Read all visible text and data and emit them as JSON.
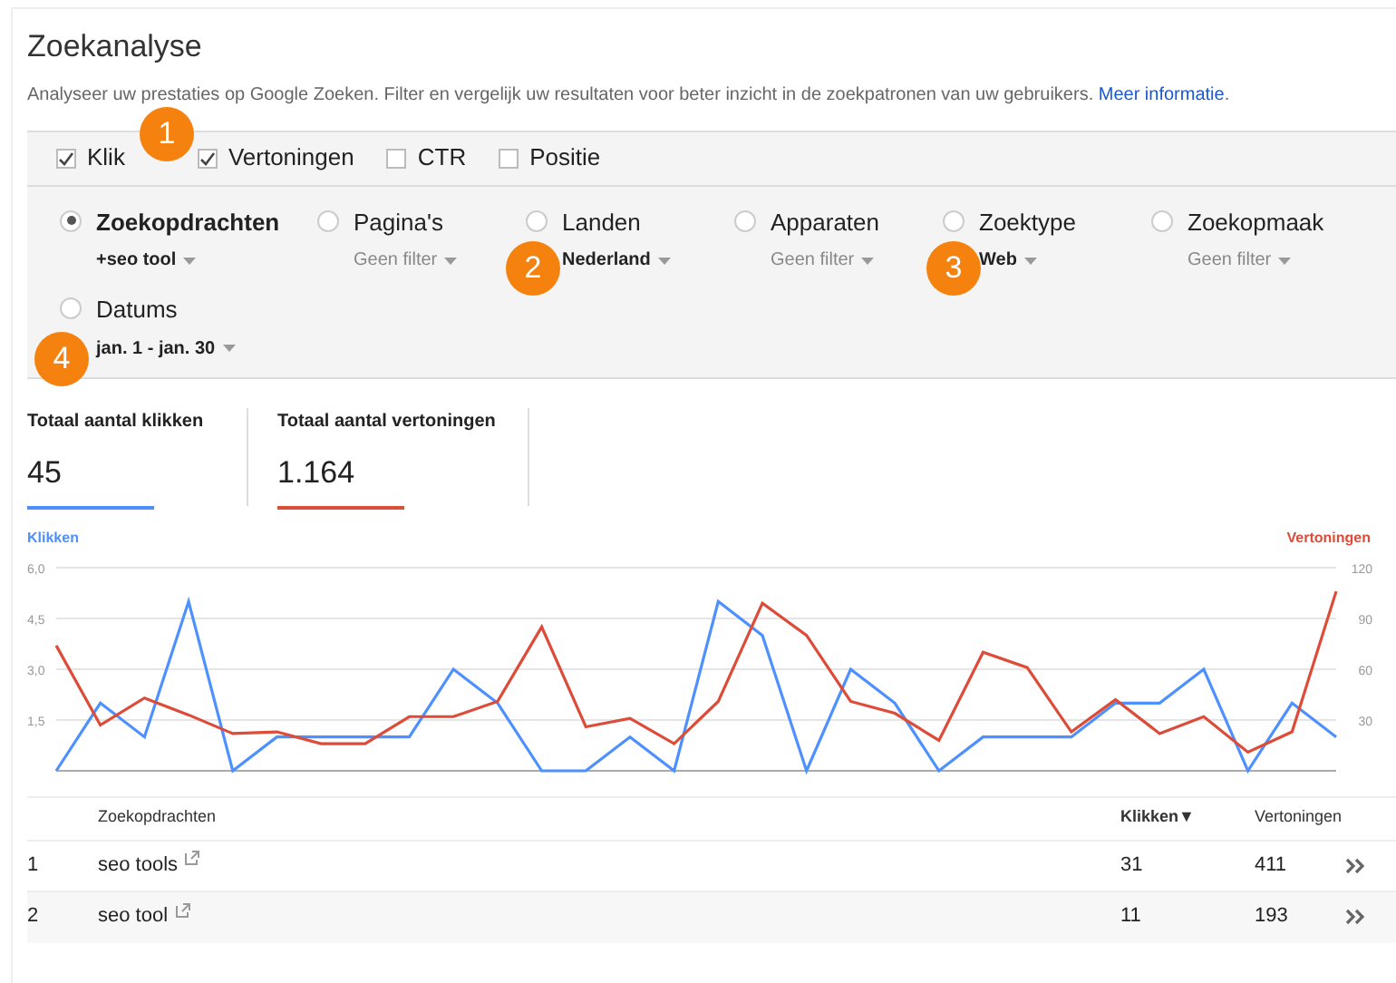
{
  "page": {
    "title": "Zoekanalyse",
    "description": "Analyseer uw prestaties op Google Zoeken. Filter en vergelijk uw resultaten voor beter inzicht in de zoekpatronen van uw gebruikers.",
    "link": "Meer informatie",
    "link_end": "."
  },
  "metrics": [
    {
      "label": "Klik",
      "checked": true
    },
    {
      "label": "Vertoningen",
      "checked": true
    },
    {
      "label": "CTR",
      "checked": false
    },
    {
      "label": "Positie",
      "checked": false
    }
  ],
  "filters": [
    {
      "label": "Zoekopdrachten",
      "selected": true,
      "value": "+seo tool",
      "filtered": true
    },
    {
      "label": "Pagina's",
      "selected": false,
      "value": "Geen filter",
      "filtered": false
    },
    {
      "label": "Landen",
      "selected": false,
      "value": "Nederland",
      "filtered": true
    },
    {
      "label": "Apparaten",
      "selected": false,
      "value": "Geen filter",
      "filtered": false
    },
    {
      "label": "Zoektype",
      "selected": false,
      "value": "Web",
      "filtered": true
    },
    {
      "label": "Zoekopmaak",
      "selected": false,
      "value": "Geen filter",
      "filtered": false
    },
    {
      "label": "Datums",
      "selected": false,
      "value": "jan. 1 - jan. 30",
      "filtered": true
    }
  ],
  "markers": [
    "1",
    "2",
    "3",
    "4"
  ],
  "totals": [
    {
      "label": "Totaal aantal klikken",
      "value": "45",
      "color": "#4d90fe"
    },
    {
      "label": "Totaal aantal vertoningen",
      "value": "1.164",
      "color": "#dd4b39"
    }
  ],
  "chart": {
    "chart_data": {
      "type": "line",
      "grid": true,
      "ylim": [
        0,
        6
      ],
      "y2lim": [
        0,
        120
      ],
      "y2ticks": [
        120,
        90,
        60,
        30
      ],
      "yticks": [
        {
          "value": 6,
          "label": "6,0"
        },
        {
          "value": 4.5,
          "label": "4,5"
        },
        {
          "value": 3,
          "label": "3,0"
        },
        {
          "value": 1.5,
          "label": "1,5"
        }
      ],
      "series": [
        {
          "name": "Klikken",
          "color": "#4d90fe",
          "axis": "y",
          "values": [
            0,
            2,
            1,
            5,
            0,
            1,
            1,
            1,
            1,
            3,
            2,
            0,
            0,
            1,
            0,
            5,
            4,
            0,
            3,
            2,
            0,
            1,
            1,
            1,
            2,
            2,
            3,
            0,
            2,
            1
          ]
        },
        {
          "name": "Vertoningen",
          "color": "#dd4b39",
          "axis": "y2",
          "values": [
            74,
            27,
            43,
            33,
            22,
            23,
            16,
            16,
            32,
            32,
            41,
            85,
            26,
            31,
            16,
            41,
            99,
            80,
            41,
            34,
            18,
            70,
            61,
            23,
            42,
            22,
            32,
            11,
            23,
            106
          ]
        }
      ]
    }
  },
  "table": {
    "columns": [
      {
        "label": "Zoekopdrachten",
        "sorted": false
      },
      {
        "label": "Klikken▼",
        "sorted": true
      },
      {
        "label": "Vertoningen",
        "sorted": false
      }
    ],
    "rows": [
      {
        "index": "1",
        "query": "seo tools",
        "clicks": "31",
        "impressions": "411"
      },
      {
        "index": "2",
        "query": "seo tool",
        "clicks": "11",
        "impressions": "193"
      }
    ]
  }
}
